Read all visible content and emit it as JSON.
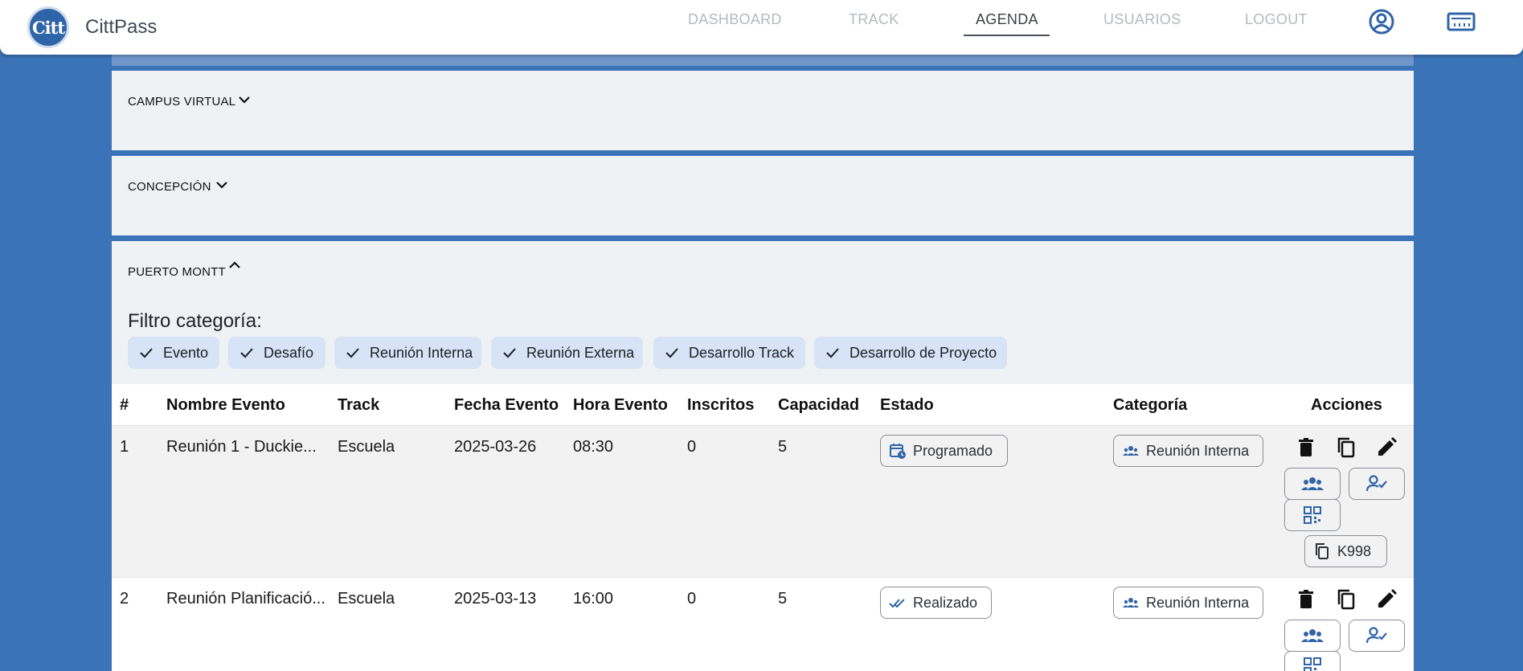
{
  "app": {
    "logo_text": "Citt",
    "brand": "CittPass"
  },
  "nav": {
    "dashboard": "DASHBOARD",
    "track": "TRACK",
    "agenda": "AGENDA",
    "usuarios": "USUARIOS",
    "logout": "LOGOUT",
    "active": "AGENDA"
  },
  "sections": {
    "campus_virtual": "CAMPUS VIRTUAL",
    "concepcion": "CONCEPCIÓN",
    "puerto_montt": "PUERTO MONTT"
  },
  "filter": {
    "title": "Filtro categoría:",
    "chips": [
      "Evento",
      "Desafío",
      "Reunión Interna",
      "Reunión Externa",
      "Desarrollo Track",
      "Desarrollo de Proyecto"
    ]
  },
  "table": {
    "headers": [
      "#",
      "Nombre Evento",
      "Track",
      "Fecha Evento",
      "Hora Evento",
      "Inscritos",
      "Capacidad",
      "Estado",
      "Categoría",
      "Acciones"
    ],
    "rows": [
      {
        "num": "1",
        "name": "Reunión 1 - Duckie...",
        "track": "Escuela",
        "date": "2025-03-26",
        "time": "08:30",
        "inscritos": "0",
        "capacidad": "5",
        "estado": "Programado",
        "categoria": "Reunión Interna",
        "code": "K998"
      },
      {
        "num": "2",
        "name": "Reunión Planificació...",
        "track": "Escuela",
        "date": "2025-03-13",
        "time": "16:00",
        "inscritos": "0",
        "capacidad": "5",
        "estado": "Realizado",
        "categoria": "Reunión Interna"
      }
    ]
  },
  "colors": {
    "background": "#3a73b8",
    "accent": "#2f64a8",
    "chip": "#d7e3f6",
    "section": "#eff2f4"
  },
  "icons": [
    "account-circle-icon",
    "ticket-icon",
    "chevron-down-icon",
    "chevron-up-icon",
    "check-icon",
    "calendar-clock-icon",
    "group-icon",
    "double-check-icon",
    "trash-icon",
    "copy-icon",
    "pencil-icon",
    "person-check-icon",
    "qr-code-icon"
  ]
}
